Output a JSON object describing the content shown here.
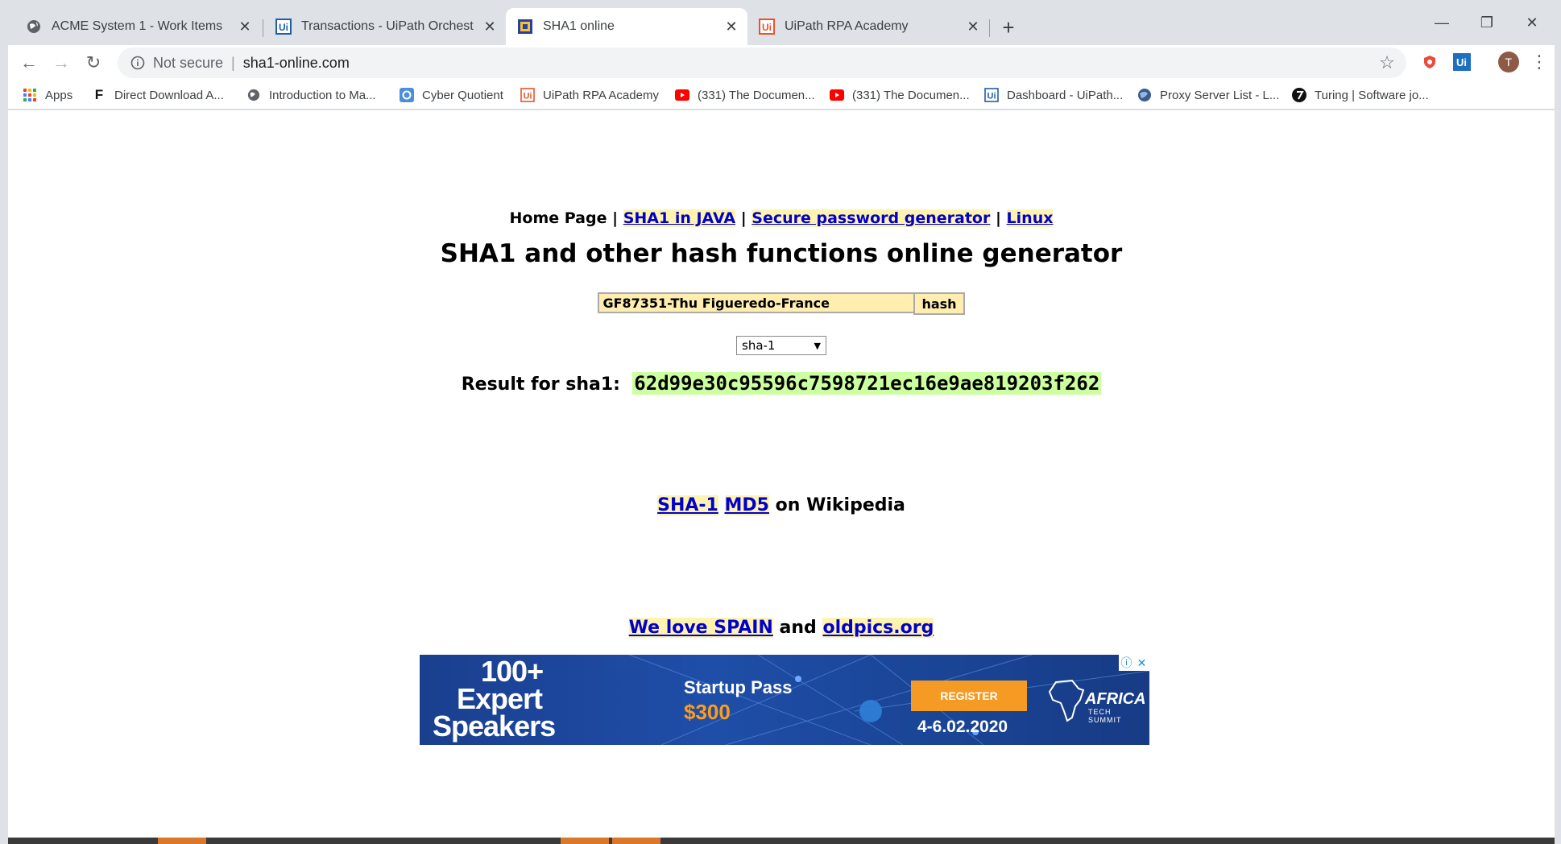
{
  "browser": {
    "tabs": [
      {
        "title": "ACME System 1 - Work Items",
        "icon": "globe-icon",
        "active": false
      },
      {
        "title": "Transactions - UiPath Orchestrator",
        "icon": "uipath-icon",
        "active": false
      },
      {
        "title": "SHA1 online",
        "icon": "sha1-favicon",
        "active": true
      },
      {
        "title": "UiPath RPA Academy",
        "icon": "uipath-academy-icon",
        "active": false
      }
    ],
    "new_tab": "+",
    "window_controls": {
      "minimize": "—",
      "restore": "❐",
      "close": "✕"
    },
    "toolbar": {
      "back": "←",
      "forward": "→",
      "reload": "↻",
      "security_label": "Not secure",
      "url": "sha1-online.com",
      "star": "☆",
      "extension_uipath": "Ui",
      "profile_initial": "T",
      "menu": "⋮"
    },
    "bookmarks": [
      {
        "label": "Apps",
        "icon": "apps-grid-icon"
      },
      {
        "label": "Direct Download A...",
        "icon": "f-icon"
      },
      {
        "label": "Introduction to Ma...",
        "icon": "globe-icon"
      },
      {
        "label": "Cyber Quotient",
        "icon": "cq-icon"
      },
      {
        "label": "UiPath RPA Academy",
        "icon": "uipath-academy-icon"
      },
      {
        "label": "(331) The Documen...",
        "icon": "youtube-icon"
      },
      {
        "label": "(331) The Documen...",
        "icon": "youtube-icon"
      },
      {
        "label": "Dashboard - UiPath...",
        "icon": "uipath-icon"
      },
      {
        "label": "Proxy Server List - L...",
        "icon": "globe-icon"
      },
      {
        "label": "Turing | Software jo...",
        "icon": "turing-icon"
      }
    ]
  },
  "page": {
    "nav": {
      "home": "Home Page",
      "sep": "|",
      "links": [
        "SHA1 in JAVA",
        "Secure password generator",
        "Linux"
      ]
    },
    "title": "SHA1 and other hash functions online generator",
    "input_value": "GF87351-Thu Figueredo-France",
    "hash_button": "hash",
    "algorithm": "sha-1",
    "result_label": "Result for sha1:",
    "result_value": "62d99e30c95596c7598721ec16e9ae819203f262",
    "wiki": {
      "link1": "SHA-1",
      "link2": "MD5",
      "suffix": "on Wikipedia"
    },
    "promo": {
      "link1": "We love SPAIN",
      "and": "and",
      "link2": "oldpics.org"
    },
    "ad": {
      "headline_1": "100+",
      "headline_2": "Expert",
      "headline_3": "Speakers",
      "pass": "Startup Pass",
      "price": "$300",
      "cta": "REGISTER",
      "dates": "4-6.02.2020",
      "logo_text": "AFRICA",
      "logo_sub": "TECH SUMMIT"
    }
  },
  "colors": {
    "link": "#0000cc",
    "link_bg": "#fff3b0",
    "input_bg": "#ffeeb0",
    "result_bg": "#ccffa0",
    "ad_blue": "#1f4ea8",
    "ad_orange": "#f59a23"
  }
}
